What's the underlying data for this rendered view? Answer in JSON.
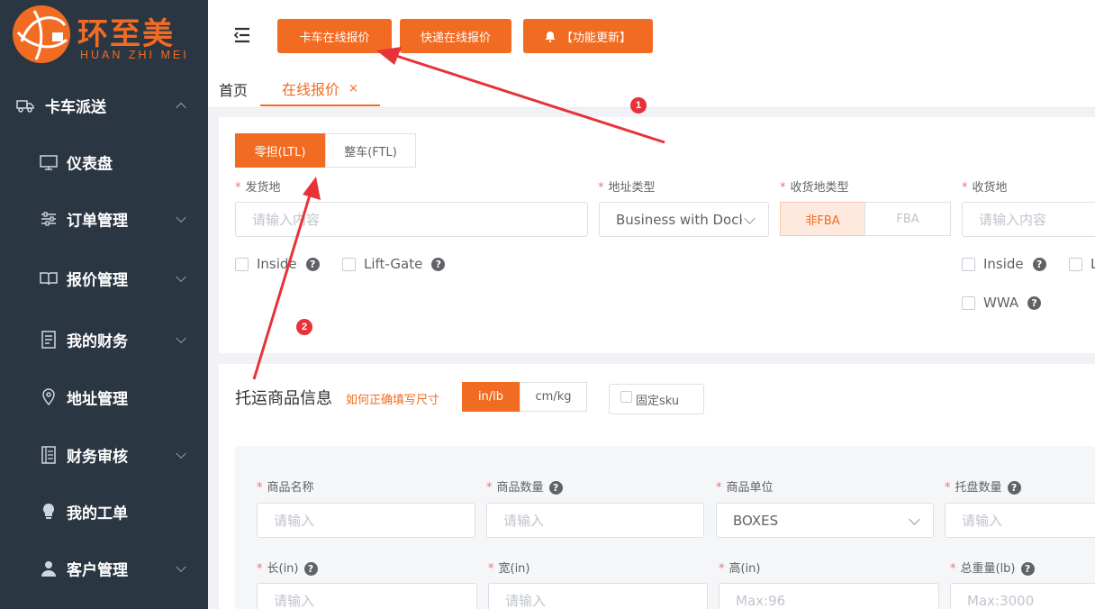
{
  "brand": {
    "name": "环至美",
    "subtitle": "HUAN ZHI MEI",
    "color": "#f26b22"
  },
  "sidebar": {
    "group": {
      "label": "卡车派送",
      "icon": "truck-icon"
    },
    "items": [
      {
        "label": "仪表盘",
        "icon": "monitor-icon"
      },
      {
        "label": "订单管理",
        "icon": "sliders-icon"
      },
      {
        "label": "报价管理",
        "icon": "book-icon"
      },
      {
        "label": "我的财务",
        "icon": "document-icon"
      },
      {
        "label": "地址管理",
        "icon": "location-pin-icon"
      },
      {
        "label": "财务审核",
        "icon": "ledger-icon"
      },
      {
        "label": "我的工单",
        "icon": "bulb-icon"
      },
      {
        "label": "客户管理",
        "icon": "user-icon"
      }
    ]
  },
  "topbar": {
    "buttons": [
      "卡车在线报价",
      "快递在线报价",
      "【功能更新】"
    ]
  },
  "tabs": [
    {
      "label": "首页"
    },
    {
      "label": "在线报价",
      "close": "×"
    }
  ],
  "shipment": {
    "modes": [
      "零担(LTL)",
      "整车(FTL)"
    ],
    "origin": {
      "label": "发货地",
      "placeholder": "请输入内容"
    },
    "address_type": {
      "label": "地址类型",
      "value": "Business with Dock"
    },
    "dest_type": {
      "label": "收货地类型",
      "options": [
        "非FBA",
        "FBA"
      ]
    },
    "destination": {
      "label": "收货地",
      "placeholder": "请输入内容"
    },
    "origin_checks": [
      "Inside",
      "Lift-Gate"
    ],
    "dest_checks": [
      "Inside",
      "L",
      "WWA"
    ]
  },
  "goods": {
    "title": "托运商品信息",
    "help_link": "如何正确填写尺寸",
    "units": [
      "in/lb",
      "cm/kg"
    ],
    "fixed_sku": "固定sku",
    "fields_row1": [
      {
        "label": "商品名称",
        "placeholder": "请输入"
      },
      {
        "label": "商品数量",
        "placeholder": "请输入",
        "help": "?"
      },
      {
        "label": "商品单位",
        "value": "BOXES"
      },
      {
        "label": "托盘数量",
        "placeholder": "请输入",
        "help": "?"
      }
    ],
    "fields_row2": [
      {
        "label": "长(in)",
        "placeholder": "请输入",
        "help": "?"
      },
      {
        "label": "宽(in)",
        "placeholder": "请输入"
      },
      {
        "label": "高(in)",
        "placeholder": "Max:96"
      },
      {
        "label": "总重量(lb)",
        "placeholder": "Max:3000",
        "help": "?"
      }
    ]
  },
  "annotations": {
    "badges": [
      "1",
      "2"
    ],
    "color": "#e8323a"
  }
}
